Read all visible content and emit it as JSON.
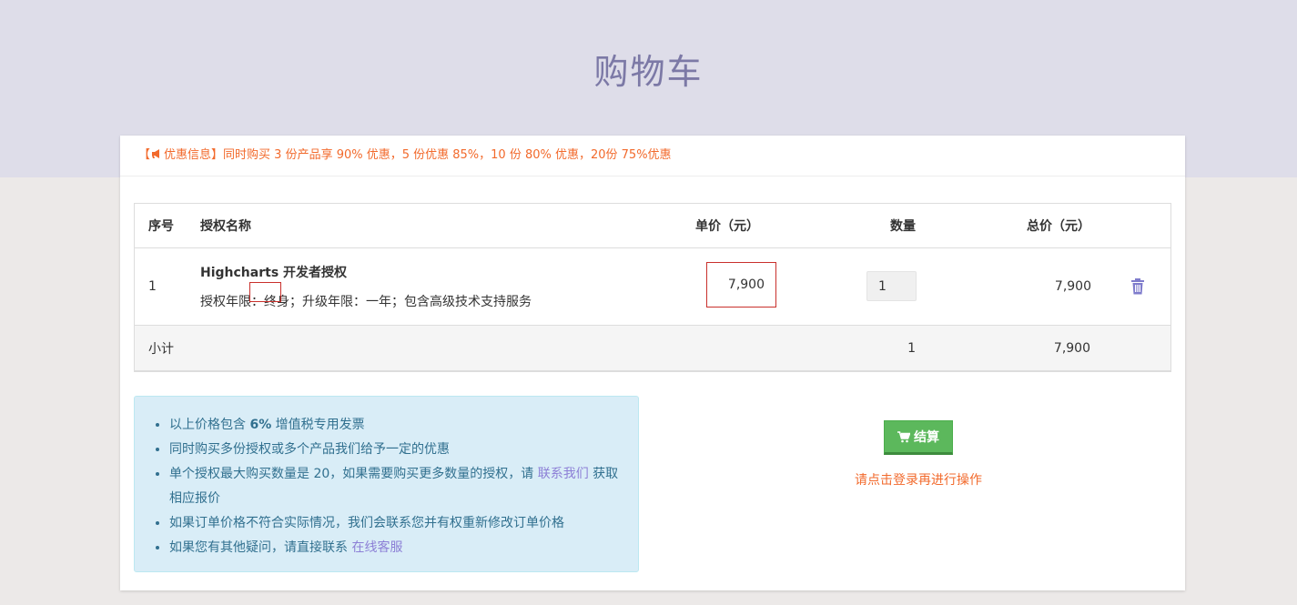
{
  "page": {
    "title": "购物车"
  },
  "promo": {
    "open_bracket": "【",
    "label": "优惠信息】",
    "text": "同时购买 3 份产品享 90% 优惠，5 份优惠 85%，10 份 80% 优惠，20份 75%优惠"
  },
  "table": {
    "headers": {
      "no": "序号",
      "name": "授权名称",
      "price": "单价（元）",
      "qty": "数量",
      "total": "总价（元）"
    },
    "item": {
      "no": "1",
      "title": "Highcharts 开发者授权",
      "desc_prefix": "授权年限",
      "desc_highlight": "：终身",
      "desc_rest": "；升级年限：一年；包含高级技术支持服务",
      "price": "7,900",
      "qty": "1",
      "total": "7,900"
    },
    "subtotal": {
      "label": "小计",
      "qty": "1",
      "total": "7,900"
    }
  },
  "info": {
    "item1_pre": "以上价格包含 ",
    "item1_bold": "6%",
    "item1_post": " 增值税专用发票",
    "item2": "同时购买多份授权或多个产品我们给予一定的优惠",
    "item3_pre": "单个授权最大购买数量是 20，如果需要购买更多数量的授权，请 ",
    "item3_link": "联系我们",
    "item3_post": " 获取相应报价",
    "item4": "如果订单价格不符合实际情况，我们会联系您并有权重新修改订单价格",
    "item5_pre": "如果您有其他疑问，请直接联系 ",
    "item5_link": "在线客服"
  },
  "checkout": {
    "label": "结算",
    "hint": "请点击登录再进行操作"
  },
  "colors": {
    "accent_purple": "#7c79a6",
    "promo_orange": "#f26a2c",
    "checkout_green": "#5cb85c"
  }
}
